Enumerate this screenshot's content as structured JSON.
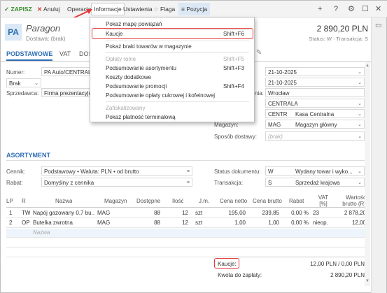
{
  "toolbar": {
    "save": "ZAPISZ",
    "cancel": "Anuluj",
    "operations": "Operacje",
    "info": "Informacje",
    "settings": "Ustawienia",
    "flag": "Flaga",
    "position": "Pozycja"
  },
  "header": {
    "badge": "PA",
    "title": "Paragon",
    "subtitle": "Dostawa: (brak)",
    "amount": "2 890,20 PLN",
    "status": "Status: W · Transakcja: S"
  },
  "tabs": [
    "PODSTAWOWE",
    "VAT",
    "DOS"
  ],
  "form": {
    "numer_label": "Numer:",
    "numer_value": "PA Auto/CENTRALA/",
    "brak_value": "Brak",
    "sprzedawca_label": "Sprzedawca:",
    "sprzedawca_value": "Firma prezentacyjna",
    "date1": "21-10-2025",
    "date2": "21-10-2025",
    "miejsce_label": "nia:",
    "miejsce_value": "Wrocław",
    "centrala": "CENTRALA",
    "centr_code": "CENTR",
    "centr_name": "Kasa Centralna",
    "magazyn_label": "Magazyn:",
    "magazyn_code": "MAG",
    "magazyn_name": "Magazyn główny",
    "sposob_label": "Sposób dostawy:",
    "sposob_placeholder": "(brak)"
  },
  "asortyment": {
    "title": "ASORTYMENT",
    "cennik_label": "Cennik:",
    "cennik_value": "Podstawowy • Waluta: PLN • od brutto",
    "rabat_label": "Rabat:",
    "rabat_value": "Domyślny z cennika",
    "status_label": "Status dokumentu:",
    "status_code": "W",
    "status_value": "Wydany towar i wyko...",
    "trans_label": "Transakcja:",
    "trans_code": "S",
    "trans_value": "Sprzedaż krajowa"
  },
  "table": {
    "headers": [
      "LP",
      "R",
      "Nazwa",
      "Magazyn",
      "Dostępne",
      "Ilość",
      "J.m.",
      "Cena netto",
      "Cena brutto",
      "Rabat",
      "VAT [%]",
      "Wartość brutto (R)"
    ],
    "rows": [
      [
        "1",
        "TW",
        "Napój gazowany 0,7 bu...",
        "MAG",
        "88",
        "12",
        "szt",
        "195,00",
        "239,85",
        "0,00 %",
        "23",
        "2 878,20"
      ],
      [
        "2",
        "OP",
        "Butelka zwrotna",
        "MAG",
        "88",
        "12",
        "szt",
        "1,00",
        "1,00",
        "0,00 %",
        "nieop.",
        "12,00"
      ]
    ],
    "new_row_placeholder": "Nazwa"
  },
  "totals": {
    "kaucje_label": "Kaucje:",
    "kaucje_value": "12,00 PLN / 0,00 PLN",
    "kwota_label": "Kwota do zapłaty:",
    "kwota_value": "2 890,20 PLN"
  },
  "menu": {
    "items": [
      {
        "label": "Pokaż mapę powiązań",
        "shortcut": "",
        "disabled": false
      },
      {
        "label": "Kaucje",
        "shortcut": "Shift+F6",
        "disabled": false
      },
      {
        "label": "Pokaż braki towarów w magazynie",
        "shortcut": "",
        "disabled": false
      },
      {
        "label": "Opłaty rolne",
        "shortcut": "Shift+F5",
        "disabled": true
      },
      {
        "label": "Podsumowanie asortymentu",
        "shortcut": "Shift+F3",
        "disabled": false
      },
      {
        "label": "Koszty dodatkowe",
        "shortcut": "",
        "disabled": false
      },
      {
        "label": "Podsumowanie promocji",
        "shortcut": "Shift+F4",
        "disabled": false
      },
      {
        "label": "Podsumowanie opłaty cukrowej i kofeinowej",
        "shortcut": "",
        "disabled": false
      },
      {
        "label": "Zafiskalizowany",
        "shortcut": "",
        "disabled": true
      },
      {
        "label": "Pokaż płatność terminalową",
        "shortcut": "",
        "disabled": false
      }
    ]
  },
  "colors": {
    "accent": "#2d6fb5",
    "save_green": "#3a8f2e",
    "cancel_red": "#d23a2a",
    "highlight_red": "#e43b3b"
  }
}
